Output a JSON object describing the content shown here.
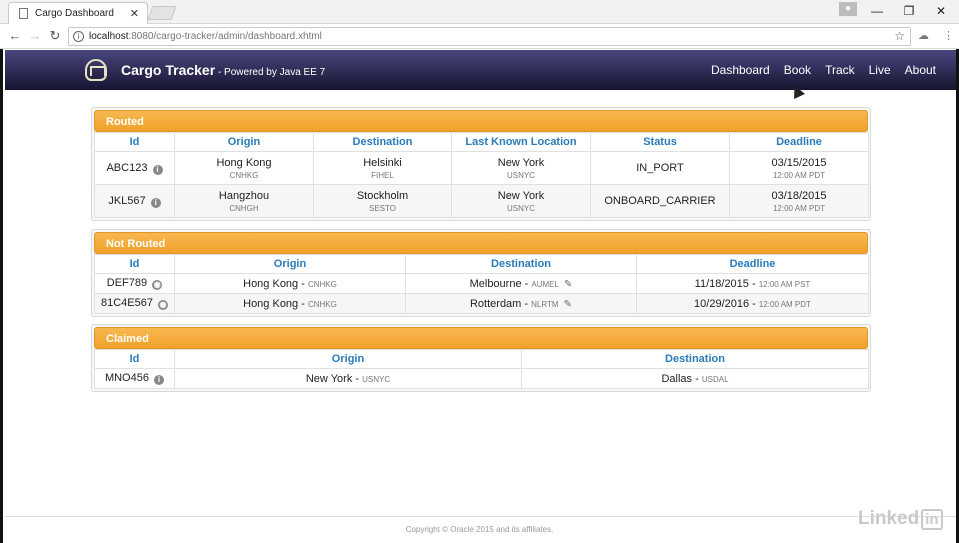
{
  "browser": {
    "tab_title": "Cargo Dashboard",
    "url_host": "localhost",
    "url_rest": ":8080/cargo-tracker/admin/dashboard.xhtml"
  },
  "app": {
    "brand": "Cargo Tracker",
    "brand_sub": " - Powered by Java EE 7",
    "nav": [
      "Dashboard",
      "Book",
      "Track",
      "Live",
      "About"
    ]
  },
  "routed": {
    "title": "Routed",
    "headers": [
      "Id",
      "Origin",
      "Destination",
      "Last Known Location",
      "Status",
      "Deadline"
    ],
    "rows": [
      {
        "id": "ABC123",
        "origin": "Hong Kong",
        "origin_code": "CNHKG",
        "dest": "Helsinki",
        "dest_code": "FIHEL",
        "loc": "New York",
        "loc_code": "USNYC",
        "status": "IN_PORT",
        "date": "03/15/2015",
        "time": "12:00 AM PDT"
      },
      {
        "id": "JKL567",
        "origin": "Hangzhou",
        "origin_code": "CNHGH",
        "dest": "Stockholm",
        "dest_code": "SESTO",
        "loc": "New York",
        "loc_code": "USNYC",
        "status": "ONBOARD_CARRIER",
        "date": "03/18/2015",
        "time": "12:00 AM PDT"
      }
    ]
  },
  "not_routed": {
    "title": "Not Routed",
    "headers": [
      "Id",
      "Origin",
      "Destination",
      "Deadline"
    ],
    "rows": [
      {
        "id": "DEF789",
        "origin": "Hong Kong",
        "origin_code": "CNHKG",
        "dest": "Melbourne",
        "dest_code": "AUMEL",
        "date": "11/18/2015",
        "time": "12:00 AM PST"
      },
      {
        "id": "81C4E567",
        "origin": "Hong Kong",
        "origin_code": "CNHKG",
        "dest": "Rotterdam",
        "dest_code": "NLRTM",
        "date": "10/29/2016",
        "time": "12:00 AM PDT"
      }
    ]
  },
  "claimed": {
    "title": "Claimed",
    "headers": [
      "Id",
      "Origin",
      "Destination"
    ],
    "rows": [
      {
        "id": "MNO456",
        "origin": "New York",
        "origin_code": "USNYC",
        "dest": "Dallas",
        "dest_code": "USDAL"
      }
    ]
  },
  "footer": "Copyright © Oracle 2015 and its affiliates.",
  "watermark": "Linked",
  "watermark_in": "in",
  "colors": {
    "panel_header": "#f0a22a",
    "navbar": "#1f1d3f",
    "header_text": "#2a7bb8"
  },
  "icons": {
    "info": "info-icon",
    "globe": "globe-icon",
    "edit": "edit-icon"
  }
}
